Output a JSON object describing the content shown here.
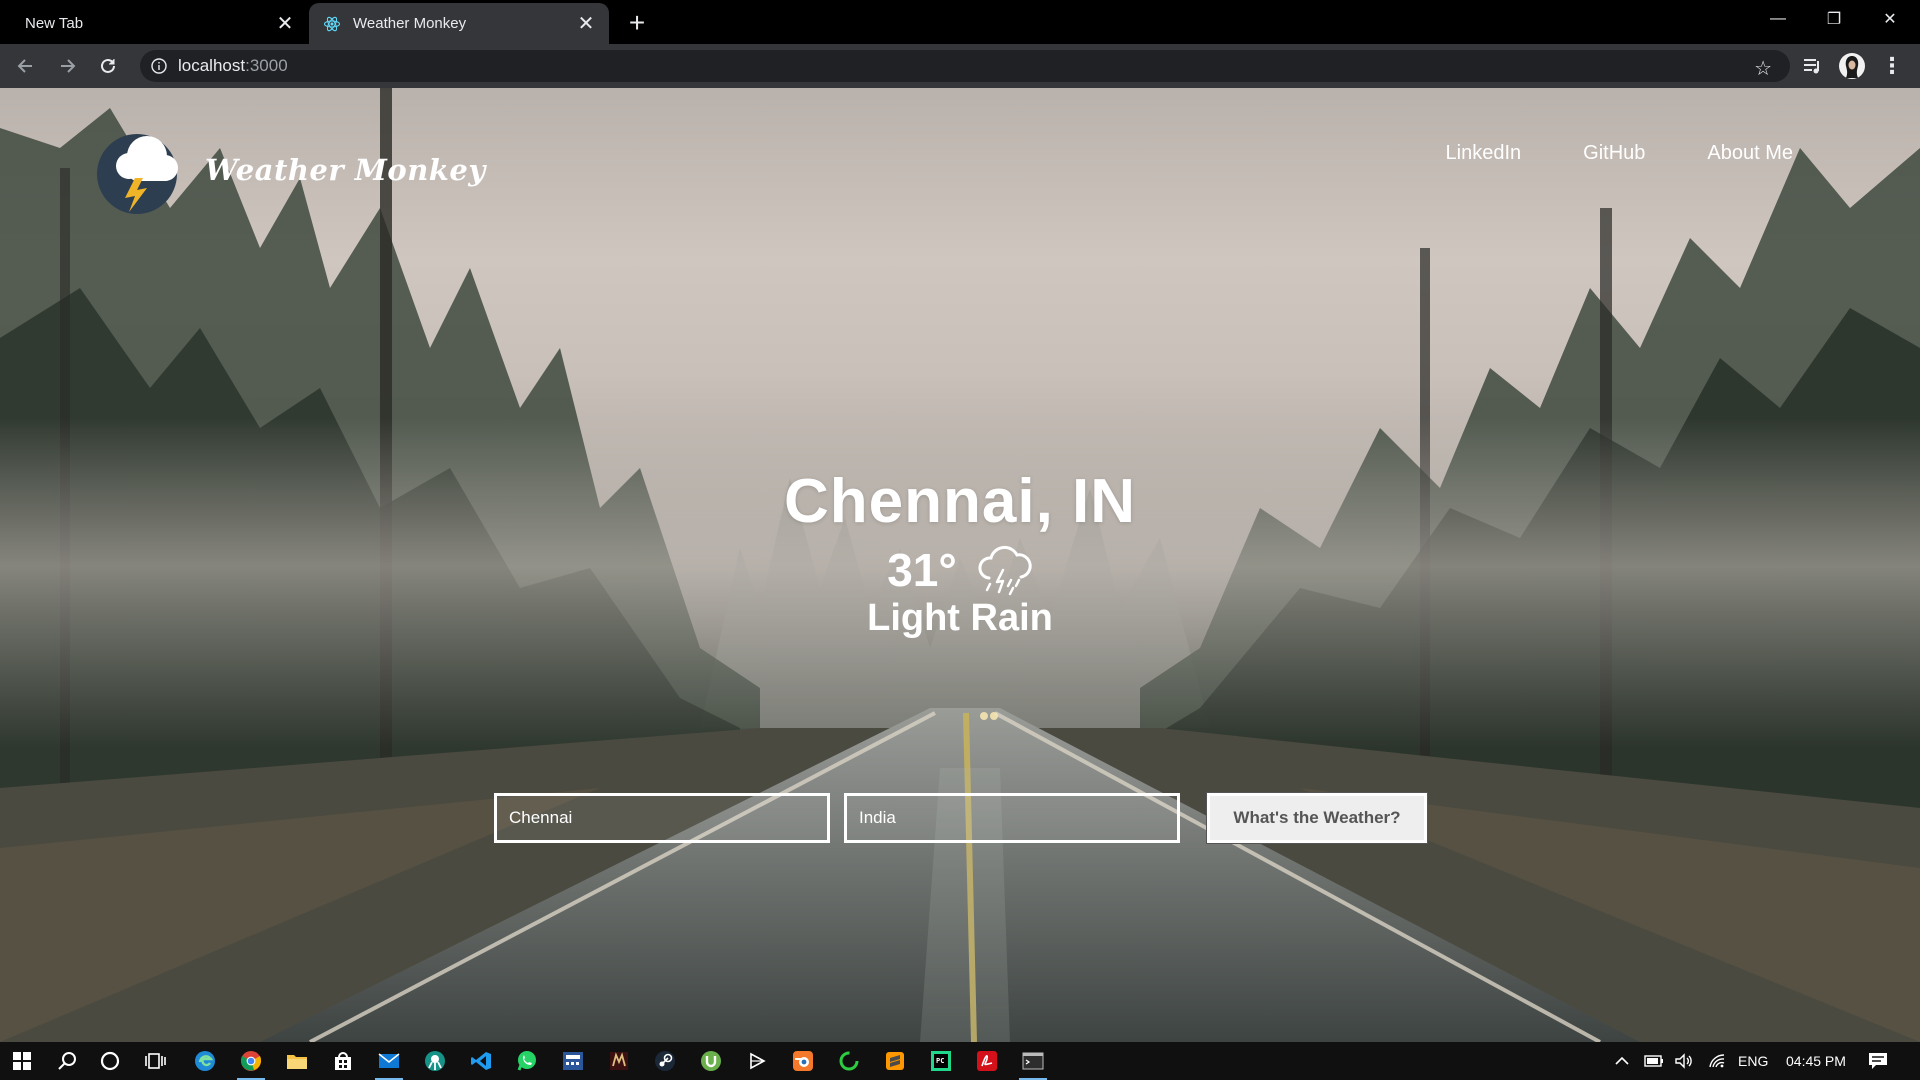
{
  "browser": {
    "tabs": [
      {
        "title": "New Tab",
        "active": false
      },
      {
        "title": "Weather Monkey",
        "active": true
      }
    ],
    "url": {
      "host": "localhost",
      "port": ":3000"
    }
  },
  "site": {
    "brand": "Weather Monkey",
    "nav": [
      "LinkedIn",
      "GitHub",
      "About Me"
    ]
  },
  "weather": {
    "location": "Chennai, IN",
    "temperature": "31°",
    "condition": "Light Rain",
    "condition_icon": "cloud-rain-lightning-icon"
  },
  "form": {
    "city_value": "Chennai",
    "country_value": "India",
    "submit_label": "What's the Weather?"
  },
  "taskbar": {
    "language": "ENG",
    "time": "04:45 PM"
  },
  "colors": {
    "tab_bar": "#000000",
    "toolbar": "#35363a",
    "omnibox": "#202124",
    "taskbar": "#101010",
    "logo_circle": "#2c3e50",
    "logo_bolt": "#f0b429"
  }
}
